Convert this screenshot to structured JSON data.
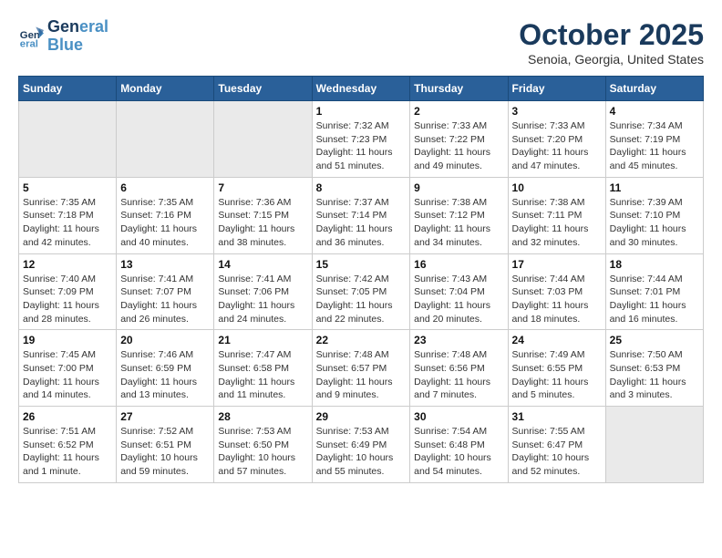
{
  "header": {
    "logo_line1": "General",
    "logo_line2": "Blue",
    "month": "October 2025",
    "location": "Senoia, Georgia, United States"
  },
  "days_of_week": [
    "Sunday",
    "Monday",
    "Tuesday",
    "Wednesday",
    "Thursday",
    "Friday",
    "Saturday"
  ],
  "weeks": [
    [
      {
        "day": "",
        "info": ""
      },
      {
        "day": "",
        "info": ""
      },
      {
        "day": "",
        "info": ""
      },
      {
        "day": "1",
        "info": "Sunrise: 7:32 AM\nSunset: 7:23 PM\nDaylight: 11 hours\nand 51 minutes."
      },
      {
        "day": "2",
        "info": "Sunrise: 7:33 AM\nSunset: 7:22 PM\nDaylight: 11 hours\nand 49 minutes."
      },
      {
        "day": "3",
        "info": "Sunrise: 7:33 AM\nSunset: 7:20 PM\nDaylight: 11 hours\nand 47 minutes."
      },
      {
        "day": "4",
        "info": "Sunrise: 7:34 AM\nSunset: 7:19 PM\nDaylight: 11 hours\nand 45 minutes."
      }
    ],
    [
      {
        "day": "5",
        "info": "Sunrise: 7:35 AM\nSunset: 7:18 PM\nDaylight: 11 hours\nand 42 minutes."
      },
      {
        "day": "6",
        "info": "Sunrise: 7:35 AM\nSunset: 7:16 PM\nDaylight: 11 hours\nand 40 minutes."
      },
      {
        "day": "7",
        "info": "Sunrise: 7:36 AM\nSunset: 7:15 PM\nDaylight: 11 hours\nand 38 minutes."
      },
      {
        "day": "8",
        "info": "Sunrise: 7:37 AM\nSunset: 7:14 PM\nDaylight: 11 hours\nand 36 minutes."
      },
      {
        "day": "9",
        "info": "Sunrise: 7:38 AM\nSunset: 7:12 PM\nDaylight: 11 hours\nand 34 minutes."
      },
      {
        "day": "10",
        "info": "Sunrise: 7:38 AM\nSunset: 7:11 PM\nDaylight: 11 hours\nand 32 minutes."
      },
      {
        "day": "11",
        "info": "Sunrise: 7:39 AM\nSunset: 7:10 PM\nDaylight: 11 hours\nand 30 minutes."
      }
    ],
    [
      {
        "day": "12",
        "info": "Sunrise: 7:40 AM\nSunset: 7:09 PM\nDaylight: 11 hours\nand 28 minutes."
      },
      {
        "day": "13",
        "info": "Sunrise: 7:41 AM\nSunset: 7:07 PM\nDaylight: 11 hours\nand 26 minutes."
      },
      {
        "day": "14",
        "info": "Sunrise: 7:41 AM\nSunset: 7:06 PM\nDaylight: 11 hours\nand 24 minutes."
      },
      {
        "day": "15",
        "info": "Sunrise: 7:42 AM\nSunset: 7:05 PM\nDaylight: 11 hours\nand 22 minutes."
      },
      {
        "day": "16",
        "info": "Sunrise: 7:43 AM\nSunset: 7:04 PM\nDaylight: 11 hours\nand 20 minutes."
      },
      {
        "day": "17",
        "info": "Sunrise: 7:44 AM\nSunset: 7:03 PM\nDaylight: 11 hours\nand 18 minutes."
      },
      {
        "day": "18",
        "info": "Sunrise: 7:44 AM\nSunset: 7:01 PM\nDaylight: 11 hours\nand 16 minutes."
      }
    ],
    [
      {
        "day": "19",
        "info": "Sunrise: 7:45 AM\nSunset: 7:00 PM\nDaylight: 11 hours\nand 14 minutes."
      },
      {
        "day": "20",
        "info": "Sunrise: 7:46 AM\nSunset: 6:59 PM\nDaylight: 11 hours\nand 13 minutes."
      },
      {
        "day": "21",
        "info": "Sunrise: 7:47 AM\nSunset: 6:58 PM\nDaylight: 11 hours\nand 11 minutes."
      },
      {
        "day": "22",
        "info": "Sunrise: 7:48 AM\nSunset: 6:57 PM\nDaylight: 11 hours\nand 9 minutes."
      },
      {
        "day": "23",
        "info": "Sunrise: 7:48 AM\nSunset: 6:56 PM\nDaylight: 11 hours\nand 7 minutes."
      },
      {
        "day": "24",
        "info": "Sunrise: 7:49 AM\nSunset: 6:55 PM\nDaylight: 11 hours\nand 5 minutes."
      },
      {
        "day": "25",
        "info": "Sunrise: 7:50 AM\nSunset: 6:53 PM\nDaylight: 11 hours\nand 3 minutes."
      }
    ],
    [
      {
        "day": "26",
        "info": "Sunrise: 7:51 AM\nSunset: 6:52 PM\nDaylight: 11 hours\nand 1 minute."
      },
      {
        "day": "27",
        "info": "Sunrise: 7:52 AM\nSunset: 6:51 PM\nDaylight: 10 hours\nand 59 minutes."
      },
      {
        "day": "28",
        "info": "Sunrise: 7:53 AM\nSunset: 6:50 PM\nDaylight: 10 hours\nand 57 minutes."
      },
      {
        "day": "29",
        "info": "Sunrise: 7:53 AM\nSunset: 6:49 PM\nDaylight: 10 hours\nand 55 minutes."
      },
      {
        "day": "30",
        "info": "Sunrise: 7:54 AM\nSunset: 6:48 PM\nDaylight: 10 hours\nand 54 minutes."
      },
      {
        "day": "31",
        "info": "Sunrise: 7:55 AM\nSunset: 6:47 PM\nDaylight: 10 hours\nand 52 minutes."
      },
      {
        "day": "",
        "info": ""
      }
    ]
  ]
}
